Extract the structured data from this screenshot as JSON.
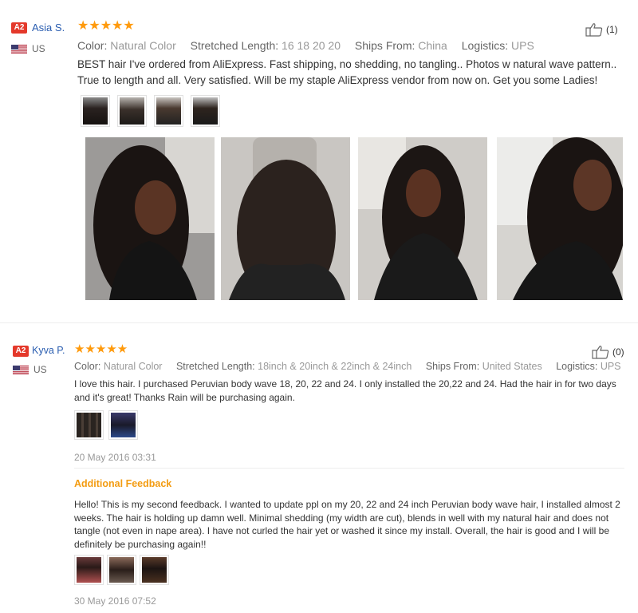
{
  "colors": {
    "accent": "#e4392b",
    "star": "#ff9a0c",
    "link": "#2a5db0",
    "feedback": "#f39c12"
  },
  "review1": {
    "badge": "A2",
    "user": "Asia S.",
    "country": "US",
    "stars": "★★★★★",
    "rating": 5,
    "attrs": [
      {
        "key": "Color:",
        "value": "Natural Color"
      },
      {
        "key": "Stretched Length:",
        "value": "16 18 20 20"
      },
      {
        "key": "Ships From:",
        "value": "China"
      },
      {
        "key": "Logistics:",
        "value": "UPS"
      }
    ],
    "text": "BEST hair I've ordered from AliExpress. Fast shipping, no shedding, no tangling.. Photos w natural wave pattern.. True to length and all. Very satisfied. Will be my staple AliExpress vendor from now on. Get you some Ladies!",
    "likes": "(1)",
    "thumb_icon": "thumbs-up-icon"
  },
  "review2": {
    "badge": "A2",
    "user": "Kyva P.",
    "country": "US",
    "stars": "★★★★★",
    "rating": 5,
    "attrs": [
      {
        "key": "Color:",
        "value": "Natural Color"
      },
      {
        "key": "Stretched Length:",
        "value": "18inch & 20inch & 22inch & 24inch"
      },
      {
        "key": "Ships From:",
        "value": "United States"
      },
      {
        "key": "Logistics:",
        "value": "UPS"
      }
    ],
    "text": "I love this hair. I purchased Peruvian body wave 18, 20, 22 and 24. I only installed the 20,22 and 24. Had the hair in for two days and it's great! Thanks Rain will be purchasing again.",
    "date": "20 May 2016 03:31",
    "likes": "(0)",
    "additional_label": "Additional Feedback",
    "additional_text": "Hello! This is my second feedback. I wanted to update ppl on my 20, 22 and 24 inch Peruvian body wave hair, I installed almost 2 weeks. The hair is holding up damn well. Minimal shedding (my width are cut), blends in well with my natural hair and does not tangle (not even in nape area). I have not curled the hair yet or washed it since my install. Overall, the hair is good and I will be definitely be purchasing again!!",
    "additional_date": "30 May 2016 07:52"
  }
}
